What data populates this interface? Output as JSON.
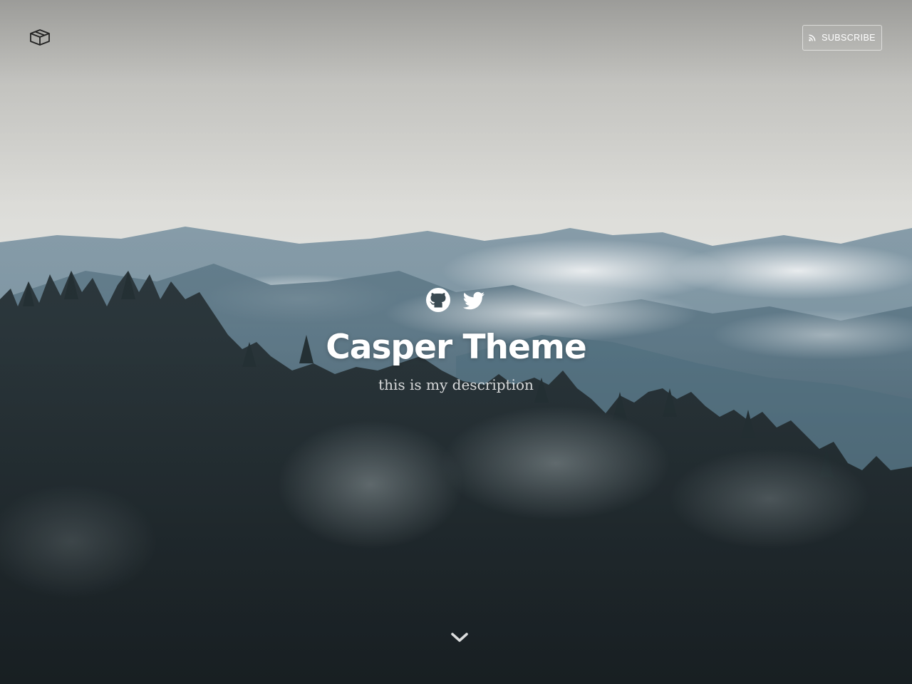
{
  "header": {
    "logo_icon": "box-icon",
    "subscribe_label": "SUBSCRIBE",
    "subscribe_icon": "rss-icon"
  },
  "hero": {
    "social_links": [
      {
        "icon": "github-icon",
        "name": "GitHub"
      },
      {
        "icon": "twitter-icon",
        "name": "Twitter"
      }
    ],
    "title": "Casper Theme",
    "description": "this is my description",
    "scroll_icon": "chevron-down-icon"
  },
  "colors": {
    "sky": "#e4e4e1",
    "mountains": "#7d96a3",
    "forest": "#1f2a2e",
    "text": "#ffffff"
  }
}
